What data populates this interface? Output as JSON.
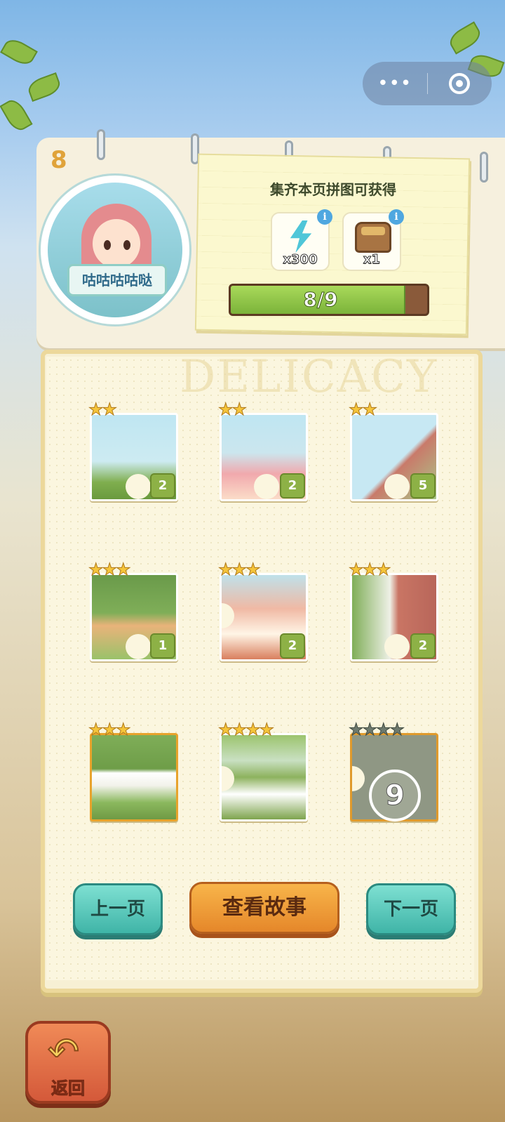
{
  "miniprogram": {
    "more_label": "•••"
  },
  "page": {
    "number": "8"
  },
  "character": {
    "name": "咕咕咕咕哒"
  },
  "reward": {
    "title": "集齐本页拼图可获得",
    "items": [
      {
        "icon": "energy-bolt-icon",
        "qty": "x300"
      },
      {
        "icon": "treasure-chest-icon",
        "qty": "x1"
      }
    ],
    "info_glyph": "i",
    "progress_text": "8/9",
    "progress_fraction": 0.889
  },
  "board": {
    "watermark": "DELICACY"
  },
  "pieces": [
    {
      "stars": 2,
      "count": "2"
    },
    {
      "stars": 2,
      "count": "2"
    },
    {
      "stars": 2,
      "count": "5"
    },
    {
      "stars": 3,
      "count": "1"
    },
    {
      "stars": 3,
      "count": "2"
    },
    {
      "stars": 3,
      "count": "2"
    },
    {
      "stars": 3,
      "count": ""
    },
    {
      "stars": 4,
      "count": ""
    },
    {
      "stars": 4,
      "count": "",
      "locked_number": "9"
    }
  ],
  "buttons": {
    "prev": "上一页",
    "story": "查看故事",
    "next": "下一页",
    "back": "返回"
  },
  "colors": {
    "accent_teal": "#3fb4a7",
    "accent_orange": "#e5872a",
    "progress_green": "#8db146"
  }
}
